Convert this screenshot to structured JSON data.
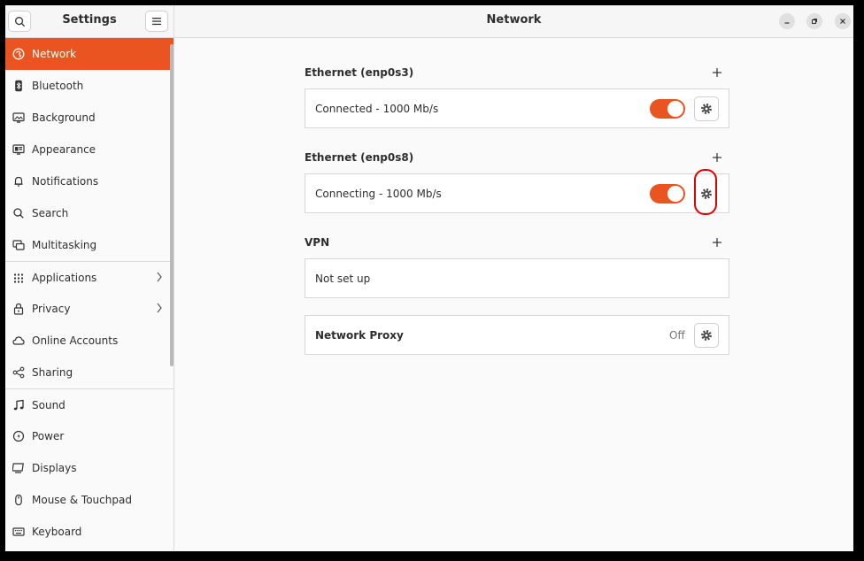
{
  "sidebar": {
    "title": "Settings",
    "items": [
      {
        "label": "Network",
        "icon": "network-icon"
      },
      {
        "label": "Bluetooth",
        "icon": "bluetooth-icon"
      },
      {
        "label": "Background",
        "icon": "background-icon"
      },
      {
        "label": "Appearance",
        "icon": "appearance-icon"
      },
      {
        "label": "Notifications",
        "icon": "bell-icon"
      },
      {
        "label": "Search",
        "icon": "search-icon"
      },
      {
        "label": "Multitasking",
        "icon": "multitasking-icon"
      },
      {
        "label": "Applications",
        "icon": "grid-icon"
      },
      {
        "label": "Privacy",
        "icon": "lock-icon"
      },
      {
        "label": "Online Accounts",
        "icon": "cloud-icon"
      },
      {
        "label": "Sharing",
        "icon": "share-icon"
      },
      {
        "label": "Sound",
        "icon": "music-note-icon"
      },
      {
        "label": "Power",
        "icon": "power-icon"
      },
      {
        "label": "Displays",
        "icon": "display-icon"
      },
      {
        "label": "Mouse & Touchpad",
        "icon": "mouse-icon"
      },
      {
        "label": "Keyboard",
        "icon": "keyboard-icon"
      }
    ]
  },
  "main": {
    "title": "Network",
    "ethernet1": {
      "label": "Ethernet (enp0s3)",
      "status": "Connected - 1000 Mb/s",
      "enabled": true
    },
    "ethernet2": {
      "label": "Ethernet (enp0s8)",
      "status": "Connecting - 1000 Mb/s",
      "enabled": true
    },
    "vpn": {
      "label": "VPN",
      "status": "Not set up"
    },
    "proxy": {
      "label": "Network Proxy",
      "status": "Off"
    }
  },
  "colors": {
    "accent": "#e95420",
    "annotation": "#e00000"
  }
}
